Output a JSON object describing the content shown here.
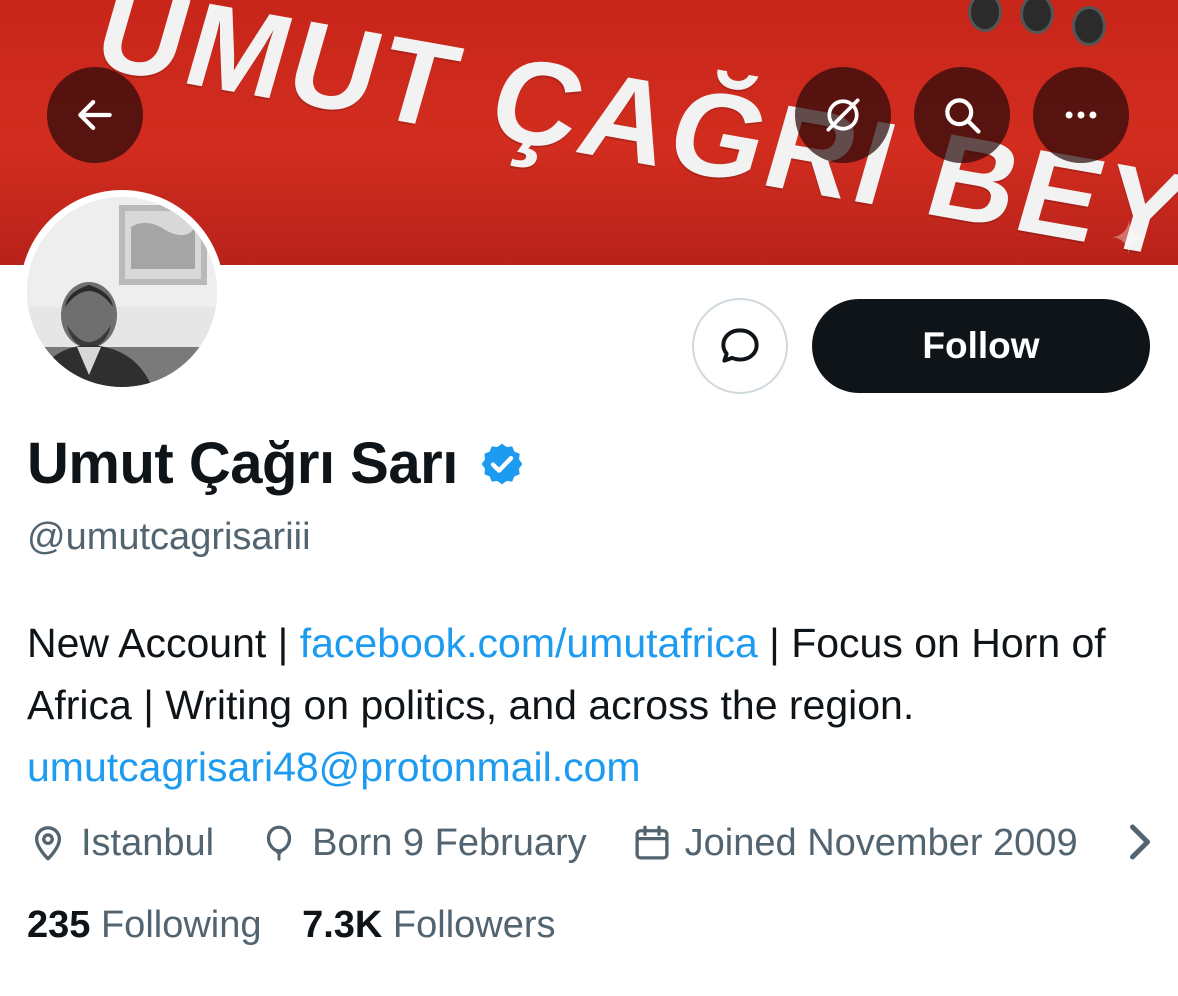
{
  "banner": {
    "text": "UMUT ÇAĞRI BEY",
    "background_color": "#c8251a"
  },
  "header": {
    "back_icon": "arrow-left-icon",
    "grok_icon": "grok-icon",
    "search_icon": "search-icon",
    "more_icon": "more-horizontal-icon"
  },
  "actions": {
    "message_icon": "message-bubble-icon",
    "follow_label": "Follow"
  },
  "profile": {
    "display_name": "Umut Çağrı Sarı",
    "verified_badge": "verified-badge-icon",
    "handle": "@umutcagrisariii",
    "bio": {
      "part1": "New Account | ",
      "link1": "facebook.com/umutafrica",
      "part2": " | Focus on Horn of Africa | Writing on politics, and across the region. ",
      "link2": "umutcagrisari48@protonmail.com"
    },
    "meta": {
      "location": "Istanbul",
      "birthday": "Born 9 February",
      "joined": "Joined November 2009"
    },
    "stats": {
      "following_count": "235",
      "following_label": "Following",
      "followers_count": "7.3K",
      "followers_label": "Followers"
    }
  },
  "colors": {
    "accent": "#1d9bf0",
    "text_primary": "#0f1419",
    "text_secondary": "#536471",
    "follow_bg": "#0f1419"
  }
}
